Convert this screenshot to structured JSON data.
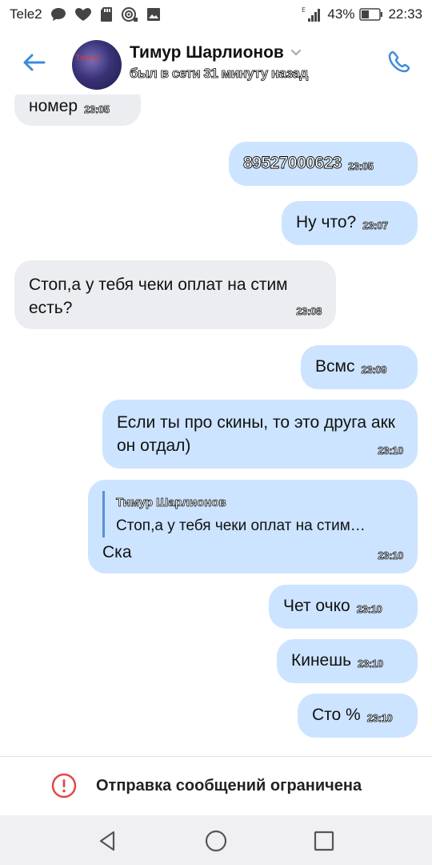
{
  "status_bar": {
    "carrier": "Tele2",
    "icons_left": [
      "chat-icon",
      "heart-icon",
      "sd-card-icon",
      "radar-icon",
      "image-icon"
    ],
    "network_label": "E",
    "battery_percent": "43%",
    "battery_level": 0.43,
    "time": "22:33"
  },
  "header": {
    "contact_name": "Тимур Шарлионов",
    "contact_status": "был в сети 31 минуту назад",
    "avatar_text": "Тимур",
    "accent_color": "#3f8ae0"
  },
  "messages": [
    {
      "direction": "in",
      "text": "номер",
      "time": "23:05"
    },
    {
      "direction": "out",
      "text": "89527000623",
      "time": "23:05"
    },
    {
      "direction": "out",
      "text": "Ну что?",
      "time": "23:07"
    },
    {
      "direction": "in",
      "text": "Стоп,а у тебя чеки оплат на стим есть?",
      "time": "23:08"
    },
    {
      "direction": "out",
      "text": "Всмс",
      "time": "23:09"
    },
    {
      "direction": "out",
      "text": "Если ты про скины, то это друга акк он отдал)",
      "time": "23:10"
    },
    {
      "direction": "out",
      "reply_to": {
        "name": "Тимур Шарлионов",
        "text": "Стоп,а у тебя чеки оплат на стим…"
      },
      "text": "Ска",
      "time": "23:10"
    },
    {
      "direction": "out",
      "text": "Чет очко",
      "time": "23:10"
    },
    {
      "direction": "out",
      "text": "Кинешь",
      "time": "23:10"
    },
    {
      "direction": "out",
      "text": "Сто %",
      "time": "23:10"
    }
  ],
  "restricted_notice": {
    "text": "Отправка сообщений ограничена",
    "icon_color": "#e64646"
  },
  "nav_bar": {
    "buttons": [
      "back-triangle-icon",
      "home-circle-icon",
      "recents-square-icon"
    ]
  }
}
